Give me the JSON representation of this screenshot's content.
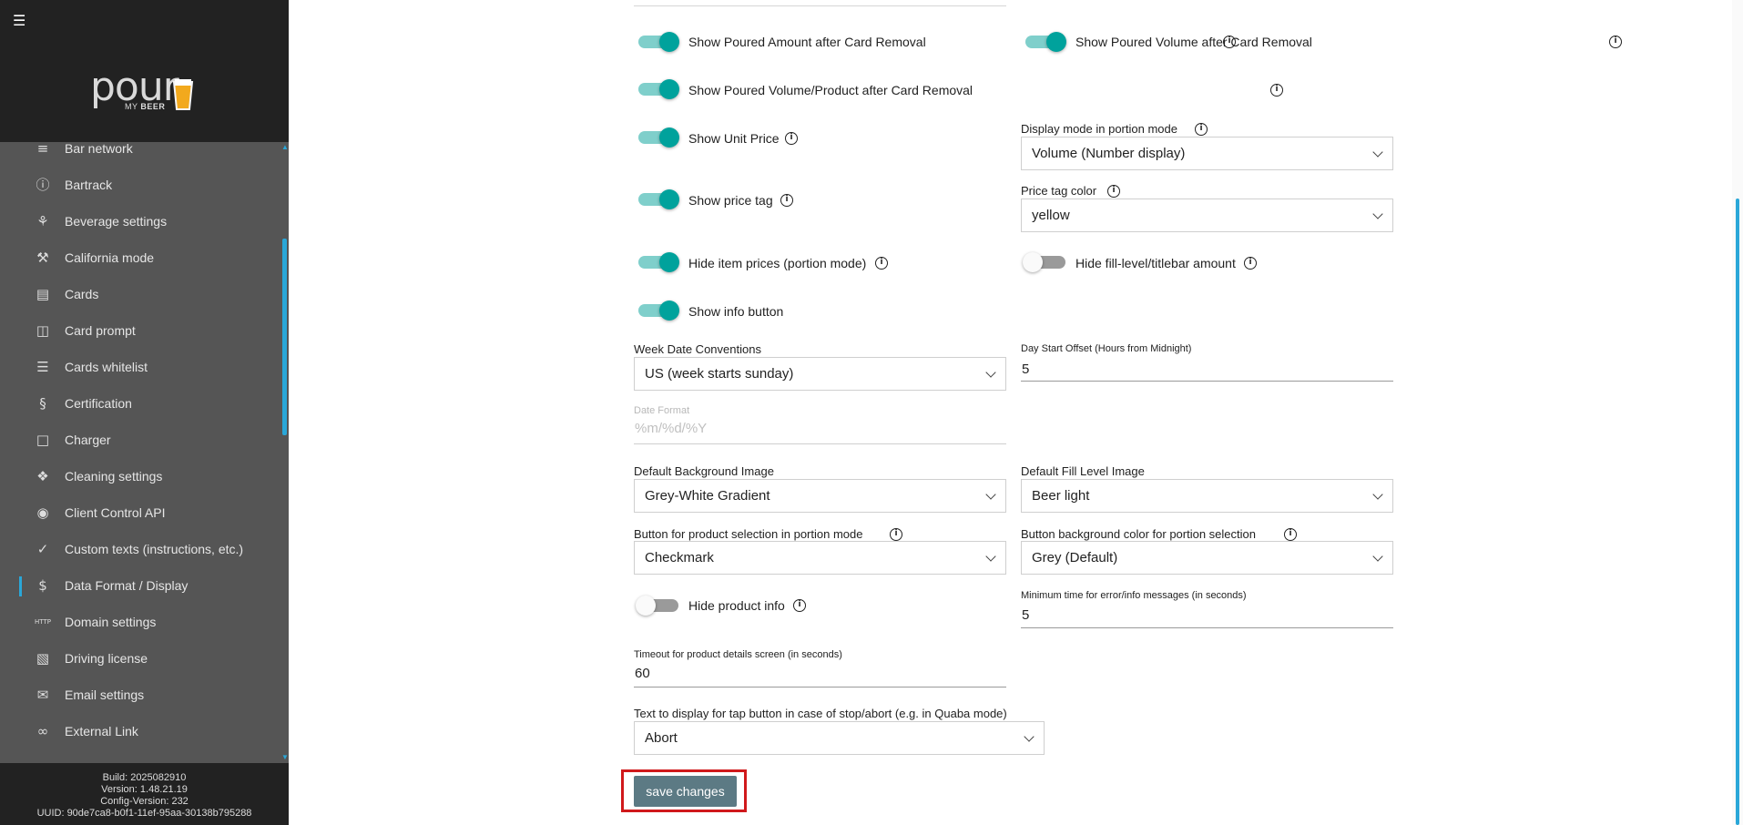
{
  "sidebar": {
    "menu_icon": "hamburger-icon",
    "logo": {
      "word": "pour",
      "sub_prefix": "MY",
      "sub_bold": "BEER"
    },
    "items": [
      {
        "label": "Bar network",
        "icon": "network-icon"
      },
      {
        "label": "Bartrack",
        "icon": "info-circle-icon"
      },
      {
        "label": "Beverage settings",
        "icon": "beverage-icon"
      },
      {
        "label": "California mode",
        "icon": "hammer-icon"
      },
      {
        "label": "Cards",
        "icon": "credit-card-icon"
      },
      {
        "label": "Card prompt",
        "icon": "message-icon"
      },
      {
        "label": "Cards whitelist",
        "icon": "list-icon"
      },
      {
        "label": "Certification",
        "icon": "section-icon"
      },
      {
        "label": "Charger",
        "icon": "square-icon"
      },
      {
        "label": "Cleaning settings",
        "icon": "drops-icon"
      },
      {
        "label": "Client Control API",
        "icon": "api-icon"
      },
      {
        "label": "Custom texts (instructions, etc.)",
        "icon": "check-icon"
      },
      {
        "label": "Data Format / Display",
        "icon": "dollar-icon",
        "active": true
      },
      {
        "label": "Domain settings",
        "icon": "http-icon"
      },
      {
        "label": "Driving license",
        "icon": "license-icon"
      },
      {
        "label": "Email settings",
        "icon": "email-icon"
      },
      {
        "label": "External Link",
        "icon": "link-icon"
      }
    ],
    "footer": {
      "build": "Build: 2025082910",
      "version": "Version: 1.48.21.19",
      "config": "Config-Version: 232",
      "uuid": "UUID: 90de7ca8-b0f1-11ef-95aa-30138b795288"
    },
    "accent_color": "#2aa7d8"
  },
  "form": {
    "toggles": {
      "poured_amount": {
        "label": "Show Poured Amount after Card Removal",
        "on": true
      },
      "poured_volume": {
        "label": "Show Poured Volume after Card Removal",
        "on": true
      },
      "poured_volume_product": {
        "label": "Show Poured Volume/Product after Card Removal",
        "on": true
      },
      "unit_price": {
        "label": "Show Unit Price",
        "on": true
      },
      "price_tag": {
        "label": "Show price tag",
        "on": true
      },
      "hide_item_prices": {
        "label": "Hide item prices (portion mode)",
        "on": true
      },
      "hide_fill_level": {
        "label": "Hide fill-level/titlebar amount",
        "on": false
      },
      "info_button": {
        "label": "Show info button",
        "on": true
      },
      "hide_product_info": {
        "label": "Hide product info",
        "on": false
      }
    },
    "display_mode": {
      "label": "Display mode in portion mode",
      "value": "Volume (Number display)"
    },
    "price_tag_color": {
      "label": "Price tag color",
      "value": "yellow"
    },
    "week_date": {
      "label": "Week Date Conventions",
      "value": "US (week starts sunday)"
    },
    "day_start": {
      "label": "Day Start Offset (Hours from Midnight)",
      "value": "5"
    },
    "date_format": {
      "label": "Date Format",
      "value": "%m/%d/%Y"
    },
    "default_bg": {
      "label": "Default Background Image",
      "value": "Grey-White Gradient"
    },
    "default_fill": {
      "label": "Default Fill Level Image",
      "value": "Beer light"
    },
    "product_button": {
      "label": "Button for product selection in portion mode",
      "value": "Checkmark"
    },
    "button_bg": {
      "label": "Button background color for portion selection",
      "value": "Grey (Default)"
    },
    "min_time": {
      "label": "Minimum time for error/info messages (in seconds)",
      "value": "5"
    },
    "timeout": {
      "label": "Timeout for product details screen (in seconds)",
      "value": "60"
    },
    "abort_text": {
      "label": "Text to display for tap button in case of stop/abort (e.g. in Quaba mode)",
      "value": "Abort"
    },
    "save_label": "save changes",
    "toggle_color": "#00a29c",
    "highlight_color": "#d0191b"
  }
}
